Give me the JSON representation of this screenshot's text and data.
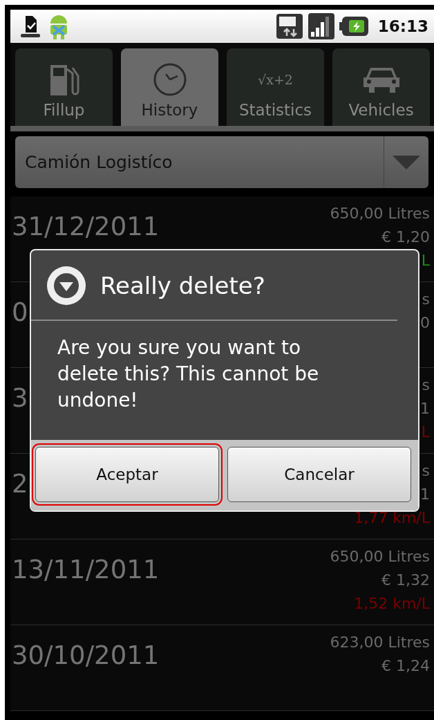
{
  "status_bar": {
    "time": "16:13"
  },
  "tabs": [
    {
      "label": "Fillup",
      "selected": false
    },
    {
      "label": "History",
      "selected": true
    },
    {
      "label": "Statistics",
      "selected": false,
      "icon_text": "√x+2"
    },
    {
      "label": "Vehicles",
      "selected": false
    }
  ],
  "vehicle_spinner": {
    "value": "Camión Logistíco"
  },
  "rows": [
    {
      "date": "31/12/2011",
      "litres": "650,00 Litres",
      "price": "€ 1,20",
      "economy": {
        "text": "L",
        "color": "#1c8a1c"
      }
    },
    {
      "date": "0",
      "litres": "s",
      "price": "0"
    },
    {
      "date": "3",
      "litres": "s",
      "price": "1",
      "economy": {
        "text": "L",
        "color": "#7a0000"
      }
    },
    {
      "date": "2",
      "litres": "s",
      "price": "1",
      "economy": {
        "text": "1,77 km/L",
        "color": "#7a0000"
      }
    },
    {
      "date": "13/11/2011",
      "litres": "650,00 Litres",
      "price": "€ 1,32",
      "economy": {
        "text": "1,52 km/L",
        "color": "#7a0000"
      }
    },
    {
      "date": "30/10/2011",
      "litres": "623,00 Litres",
      "price": "€ 1,24"
    }
  ],
  "dialog": {
    "title": "Really delete?",
    "message": "Are you sure you want to delete this? This cannot be undone!",
    "buttons": [
      {
        "label": "Aceptar",
        "focused": true
      },
      {
        "label": "Cancelar",
        "focused": false
      }
    ]
  }
}
